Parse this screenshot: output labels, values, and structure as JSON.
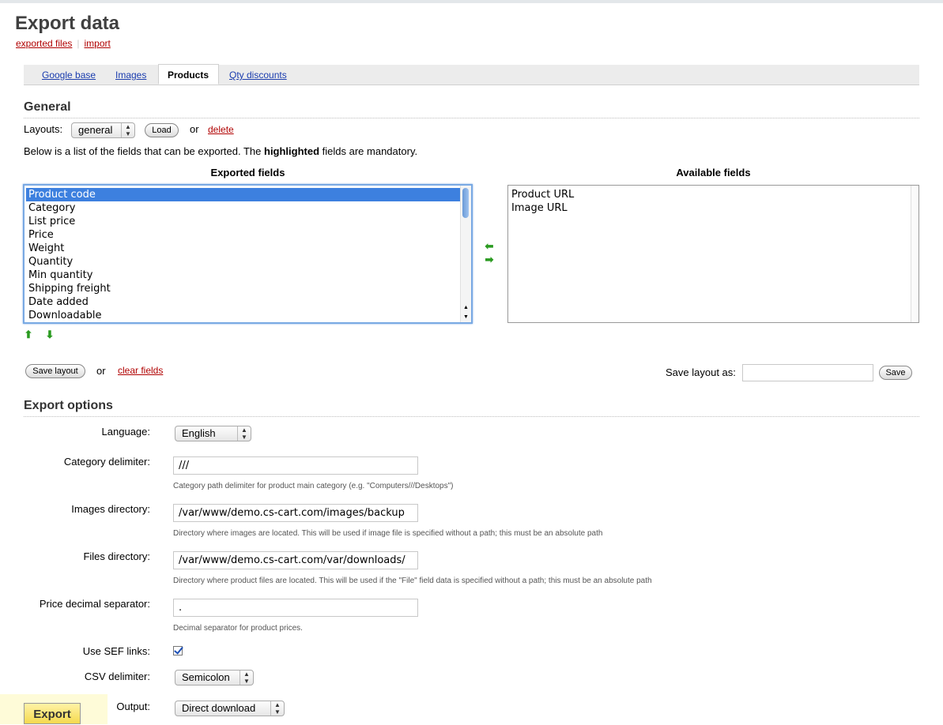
{
  "page": {
    "title": "Export data",
    "links": {
      "exported_files": "exported files",
      "import": "import"
    }
  },
  "tabs": [
    {
      "label": "Google base",
      "active": false
    },
    {
      "label": "Images",
      "active": false
    },
    {
      "label": "Products",
      "active": true
    },
    {
      "label": "Qty discounts",
      "active": false
    }
  ],
  "general": {
    "title": "General",
    "layouts_label": "Layouts:",
    "layout_selected": "general",
    "load_label": "Load",
    "or": "or",
    "delete_label": "delete",
    "description_pre": "Below is a list of the fields that can be exported. The ",
    "description_bold": "highlighted",
    "description_post": " fields are mandatory.",
    "exported_fields_title": "Exported fields",
    "available_fields_title": "Available fields",
    "exported_fields": [
      "Product code",
      "Category",
      "List price",
      "Price",
      "Weight",
      "Quantity",
      "Min quantity",
      "Shipping freight",
      "Date added",
      "Downloadable"
    ],
    "selected_field": "Product code",
    "available_fields": [
      "Product URL",
      "Image URL"
    ],
    "save_layout_label": "Save layout",
    "clear_fields_label": "clear fields",
    "save_layout_as_label": "Save layout as:",
    "save_layout_as_value": "",
    "save_label": "Save"
  },
  "export_options": {
    "title": "Export options",
    "language": {
      "label": "Language:",
      "value": "English"
    },
    "category_delimiter": {
      "label": "Category delimiter:",
      "value": "///",
      "help": "Category path delimiter for product main category (e.g. \"Computers///Desktops\")"
    },
    "images_directory": {
      "label": "Images directory:",
      "value": "/var/www/demo.cs-cart.com/images/backup",
      "help": "Directory where images are located. This will be used if image file is specified without a path; this must be an absolute path"
    },
    "files_directory": {
      "label": "Files directory:",
      "value": "/var/www/demo.cs-cart.com/var/downloads/",
      "help": "Directory where product files are located. This will be used if the \"File\" field data is specified without a path; this must be an absolute path"
    },
    "price_decimal_separator": {
      "label": "Price decimal separator:",
      "value": ".",
      "help": "Decimal separator for product prices."
    },
    "use_sef_links": {
      "label": "Use SEF links:",
      "checked": true
    },
    "csv_delimiter": {
      "label": "CSV delimiter:",
      "value": "Semicolon"
    },
    "output": {
      "label": "Output:",
      "value": "Direct download"
    }
  },
  "actions": {
    "export_label": "Export"
  },
  "icons": {
    "move_left": "arrow-left-icon",
    "move_right": "arrow-right-icon",
    "move_up": "arrow-up-icon",
    "move_down": "arrow-down-icon"
  },
  "colors": {
    "link_red": "#b00000",
    "tab_link": "#1a3cae",
    "selection": "#3d80df",
    "arrow_green": "#2a9a20",
    "export_button": "#f4d94e"
  }
}
